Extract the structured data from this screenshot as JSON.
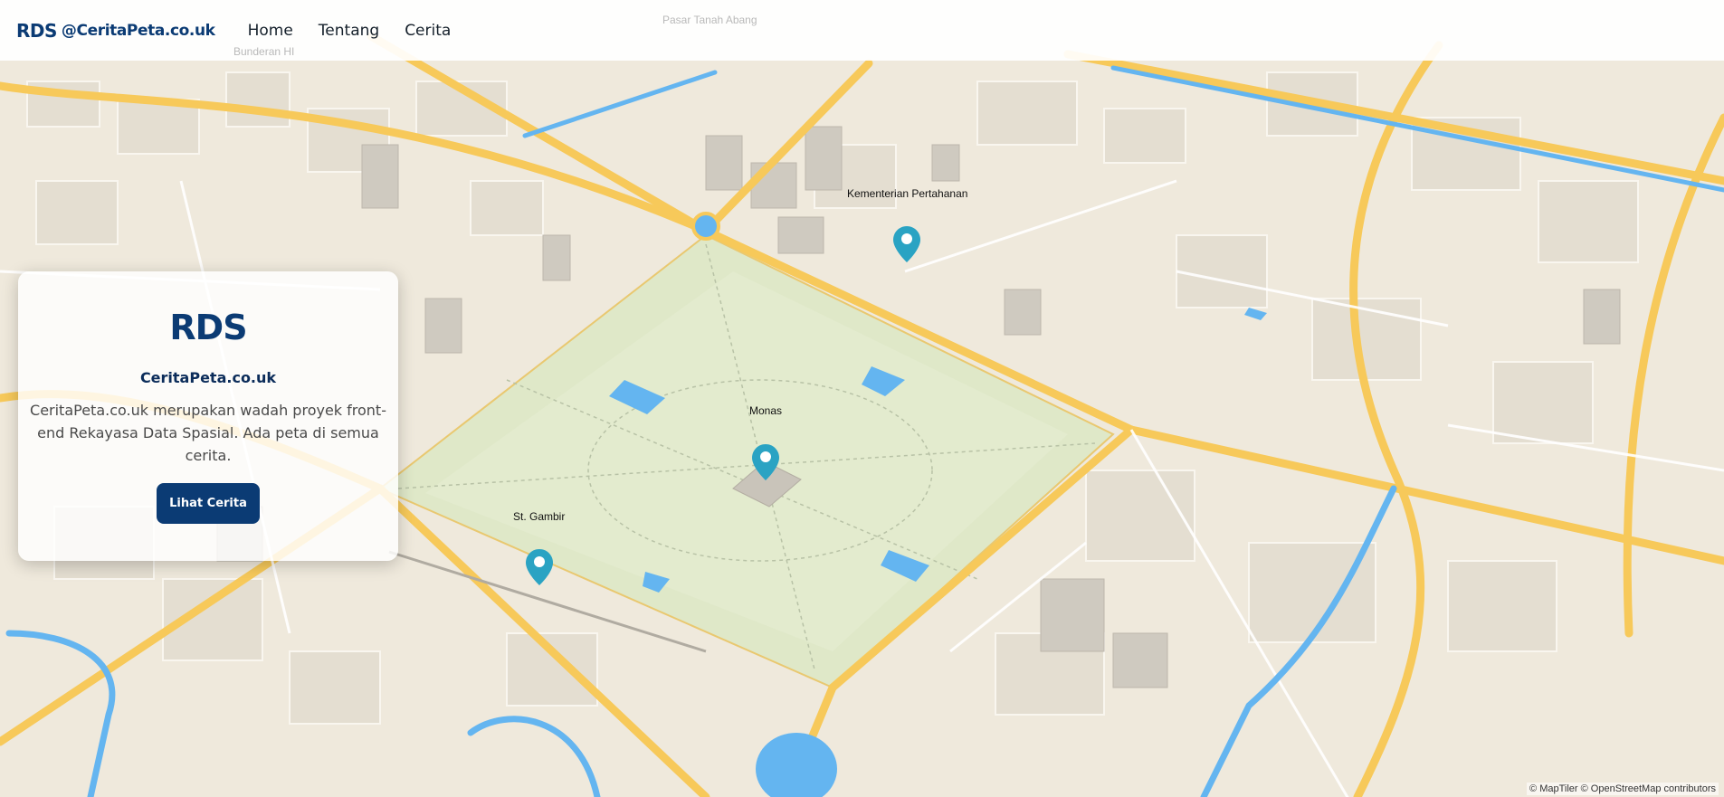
{
  "navbar": {
    "logo_text": "RDS",
    "brand_name": "@CeritaPeta.co.uk",
    "items": [
      {
        "label": "Home"
      },
      {
        "label": "Tentang"
      },
      {
        "label": "Cerita"
      }
    ]
  },
  "map": {
    "faded_labels": [
      "Pasar Tanah Abang",
      "Bunderan HI"
    ],
    "markers": [
      {
        "label": "Kementerian Pertahanan"
      },
      {
        "label": "Monas"
      },
      {
        "label": "St. Gambir"
      }
    ],
    "attribution": "© MapTiler © OpenStreetMap contributors",
    "marker_color": "#2aa3c3",
    "water_color": "#64b5f0",
    "park_color": "#dfe8c8",
    "road_color": "#f7c95a"
  },
  "info_card": {
    "logo_text": "RDS",
    "title": "CeritaPeta.co.uk",
    "description": "CeritaPeta.co.uk merupakan wadah proyek front-end Rekayasa Data Spasial. Ada peta di semua cerita.",
    "button_label": "Lihat Cerita",
    "brand_color": "#0b3b74"
  }
}
